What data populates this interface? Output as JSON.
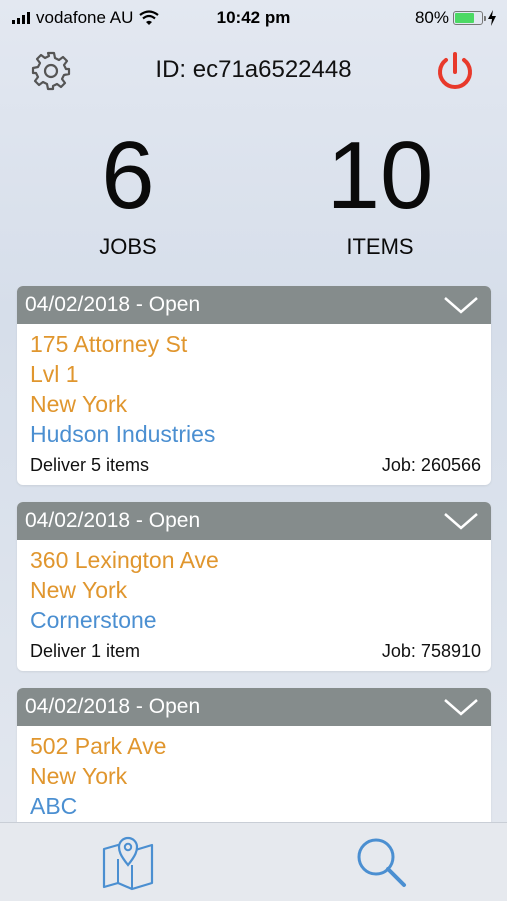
{
  "status_bar": {
    "carrier": "vodafone AU",
    "time": "10:42 pm",
    "battery": "80%",
    "battery_level": 0.8,
    "icons": [
      "signal-icon",
      "wifi-icon",
      "battery-icon",
      "charging-icon"
    ]
  },
  "header": {
    "title": "ID: ec71a6522448",
    "settings_icon": "gear-icon",
    "power_icon": "power-icon",
    "power_color": "#e8392b"
  },
  "summary": {
    "jobs_count": "6",
    "jobs_label": "JOBS",
    "items_count": "10",
    "items_label": "ITEMS"
  },
  "jobs": [
    {
      "header": "04/02/2018 - Open",
      "address_lines": [
        "175 Attorney St",
        "Lvl 1",
        "New York"
      ],
      "company": "Hudson Industries",
      "delivery": "Deliver 5 items",
      "job": "Job: 260566"
    },
    {
      "header": "04/02/2018 - Open",
      "address_lines": [
        "360 Lexington Ave",
        "New York"
      ],
      "company": "Cornerstone",
      "delivery": "Deliver 1 item",
      "job": "Job: 758910"
    },
    {
      "header": "04/02/2018 - Open",
      "address_lines": [
        "502 Park Ave",
        "New York"
      ],
      "company": "ABC"
    }
  ],
  "tabbar": {
    "tabs": [
      {
        "icon": "map-icon"
      },
      {
        "icon": "search-icon"
      }
    ]
  },
  "colors": {
    "address": "#e0962e",
    "company": "#4b8fd1",
    "card_header": "#858c8c",
    "tab_icon": "#4b8fd1"
  }
}
